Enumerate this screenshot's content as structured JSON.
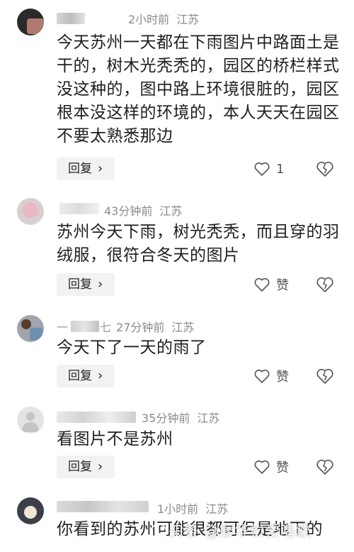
{
  "comments": [
    {
      "time": "2小时前",
      "location": "江苏",
      "text": "今天苏州一天都在下雨图片中路面土是干的，树木光秃秃的，园区的桥栏样式没这种的，图中路上环境很脏的，园区根本没这样的环境的，本人天天在园区不要太熟悉那边",
      "reply_label": "回复",
      "like_label": "1"
    },
    {
      "time": "43分钟前",
      "location": "江苏",
      "text": "苏州今天下雨，树光秃秃，而且穿的羽绒服，很符合冬天的图片",
      "reply_label": "回复",
      "like_label": "赞"
    },
    {
      "time": "27分钟前",
      "location": "江苏",
      "text": "今天下了一天的雨了",
      "reply_label": "回复",
      "like_label": "赞",
      "name_partial": "一",
      "name_tail": "七"
    },
    {
      "time": "35分钟前",
      "location": "江苏",
      "text": "看图片不是苏州",
      "reply_label": "回复",
      "like_label": "赞"
    },
    {
      "time": "1小时前",
      "location": "江苏",
      "text": "你看到的苏州可能很都可但是地下的"
    }
  ],
  "watermark": "头条 @廖华松爱唱歌",
  "icons": {
    "like": "heart-outline-icon",
    "dislike": "broken-heart-icon",
    "reply_chevron": "chevron-right-icon"
  },
  "colors": {
    "meta_text": "#8a8a8a",
    "reply_bg": "#f2f2f2",
    "body_text": "#1f1f1f"
  }
}
